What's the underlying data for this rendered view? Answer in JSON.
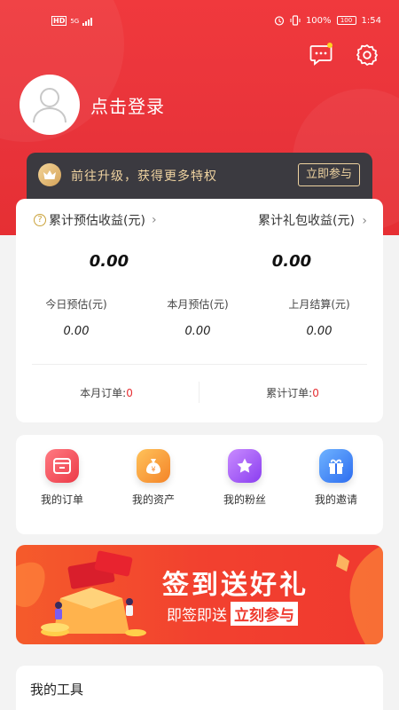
{
  "status_bar": {
    "network": "HD",
    "signal_label": "5G",
    "battery": "100",
    "battery_pct": "100%",
    "time": "1:54"
  },
  "profile": {
    "login_label": "点击登录"
  },
  "vip": {
    "text": "前往升级，获得更多特权",
    "join_label": "立即参与"
  },
  "earnings": {
    "total_estimated_label": "累计预估收益(元)",
    "total_gift_label": "累计礼包收益(元)",
    "total_estimated_value": "0.00",
    "total_gift_value": "0.00",
    "today_label": "今日预估(元)",
    "today_value": "0.00",
    "month_label": "本月预估(元)",
    "month_value": "0.00",
    "last_month_label": "上月结算(元)",
    "last_month_value": "0.00",
    "month_orders_label": "本月订单:",
    "month_orders_value": "0",
    "total_orders_label": "累计订单:",
    "total_orders_value": "0"
  },
  "functions": [
    {
      "label": "我的订单",
      "icon": "order-icon",
      "color": "#f0454f"
    },
    {
      "label": "我的资产",
      "icon": "money-bag-icon",
      "color": "#f79b2e"
    },
    {
      "label": "我的粉丝",
      "icon": "star-icon",
      "color": "#9a56ef"
    },
    {
      "label": "我的邀请",
      "icon": "gift-icon",
      "color": "#3a7cf2"
    }
  ],
  "banner": {
    "title": "签到送好礼",
    "subtitle": "即签即送",
    "join_label": "立刻参与"
  },
  "tools": {
    "title": "我的工具"
  }
}
